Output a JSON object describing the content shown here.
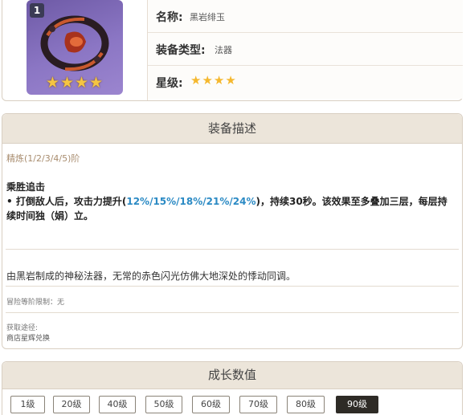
{
  "item": {
    "refinement_badge": "1",
    "thumb_stars": "★★★★",
    "icon": "obsidian-codex-catalyst-icon"
  },
  "info": {
    "name_label": "名称:",
    "name_value": "黑岩绯玉",
    "type_label": "装备类型:",
    "type_value": "法器",
    "rarity_label": "星级:",
    "rarity_value": "★★★★"
  },
  "description": {
    "header": "装备描述",
    "refinement": "精炼(1/2/3/4/5)阶",
    "passive_name": "乘胜追击",
    "passive_prefix": "• 打倒敌人后，攻击力提升(",
    "passive_values": "12%/15%/18%/21%/24%",
    "passive_suffix": ")，持续30秒。该效果至多叠加三层，每层持续时间独（娟）立。",
    "lore": "由黑岩制成的神秘法器，无常的赤色闪光仿佛大地深处的悸动同调。",
    "ascension_limit": "冒险等阶限制：无",
    "source_label": "获取途径:",
    "source_value": "商店星辉兑换"
  },
  "growth": {
    "header": "成长数值",
    "levels": [
      "1级",
      "20级",
      "40级",
      "50级",
      "60级",
      "70级",
      "80级",
      "90级"
    ],
    "selected": "90级"
  },
  "colors": {
    "highlight": "#2b8ac4",
    "star": "#f5b82e",
    "header_bg": "#ece5da",
    "active_button": "#2e2b26"
  }
}
